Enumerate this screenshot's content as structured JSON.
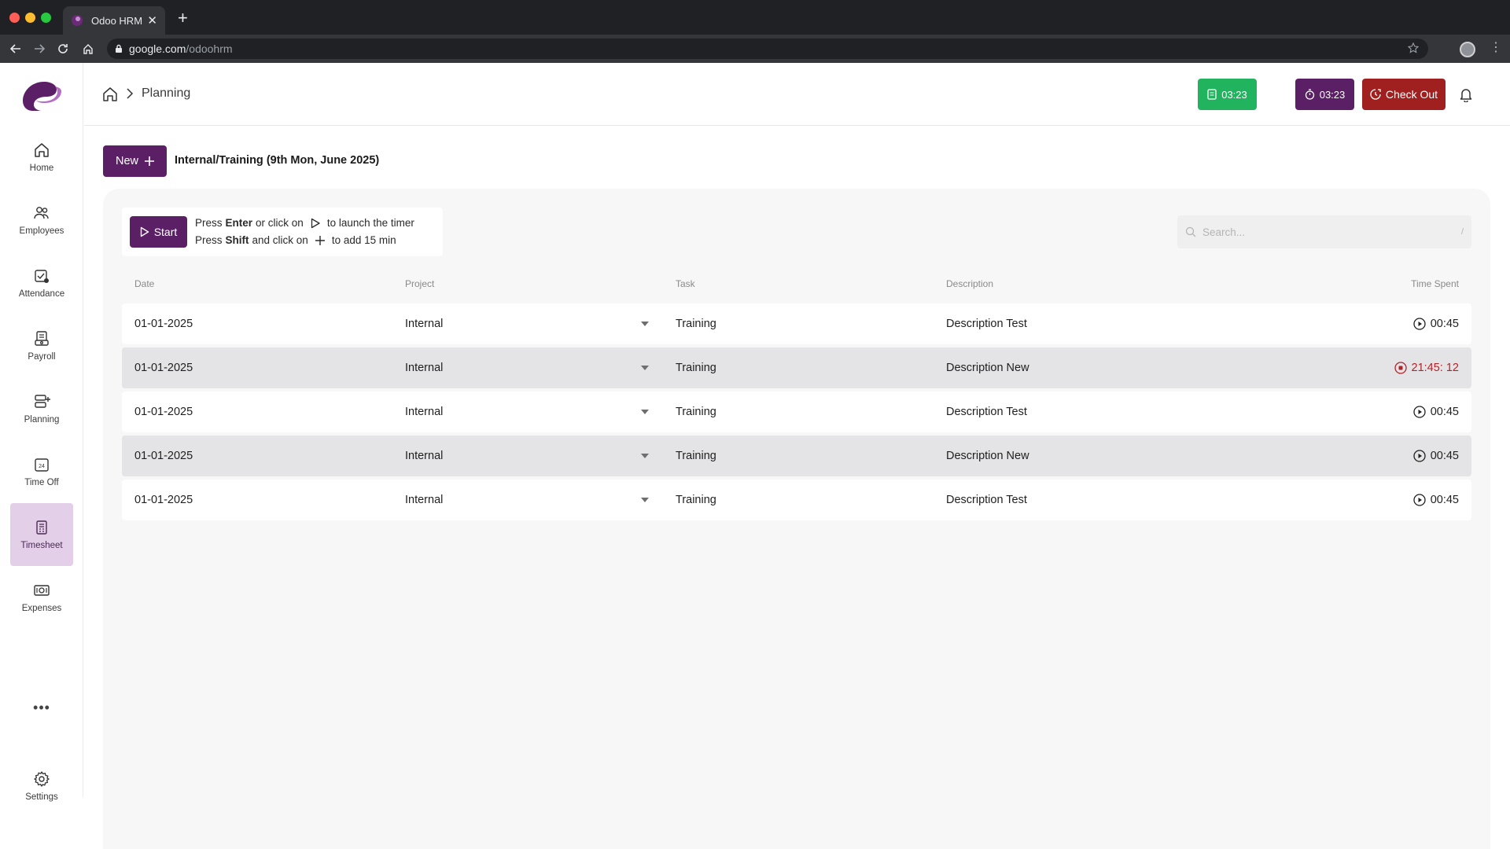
{
  "browser": {
    "tab_title": "Odoo HRM",
    "url_host": "google.com",
    "url_path": "/odoohrm"
  },
  "colors": {
    "brand_purple": "#5b1f66",
    "success_green": "#22b35e",
    "danger_red": "#a0201f",
    "active_nav_bg": "#e3cfe8"
  },
  "sidebar": {
    "items": [
      {
        "label": "Home",
        "icon": "home-icon"
      },
      {
        "label": "Employees",
        "icon": "users-icon"
      },
      {
        "label": "Attendance",
        "icon": "calendar-check-icon"
      },
      {
        "label": "Payroll",
        "icon": "payroll-icon"
      },
      {
        "label": "Planning",
        "icon": "planning-icon"
      },
      {
        "label": "Time Off",
        "icon": "time-off-icon"
      },
      {
        "label": "Timesheet",
        "icon": "timesheet-icon",
        "active": true
      },
      {
        "label": "Expenses",
        "icon": "expenses-icon"
      }
    ],
    "more": "•••",
    "settings_label": "Settings"
  },
  "header": {
    "breadcrumb_title": "Planning",
    "timer_green": "03:23",
    "timer_purple": "03:23",
    "checkout_label": "Check Out"
  },
  "actions": {
    "new_label": "New",
    "context_title": "Internal/Training (9th Mon, June 2025)"
  },
  "hint": {
    "start_label": "Start",
    "line1_pre": "Press",
    "line1_key": "Enter",
    "line1_mid": "or click on",
    "line1_post": "to launch the timer",
    "line2_pre": "Press",
    "line2_key": "Shift",
    "line2_mid": "and click on",
    "line2_post": "to add 15 min"
  },
  "search": {
    "placeholder": "Search...",
    "shortcut": "/"
  },
  "table": {
    "columns": [
      "Date",
      "Project",
      "Task",
      "Description",
      "Time Spent"
    ],
    "rows": [
      {
        "date": "01-01-2025",
        "project": "Internal",
        "task": "Training",
        "description": "Description Test",
        "time": "00:45",
        "running": false
      },
      {
        "date": "01-01-2025",
        "project": "Internal",
        "task": "Training",
        "description": "Description New",
        "time": "21:45: 12",
        "running": true
      },
      {
        "date": "01-01-2025",
        "project": "Internal",
        "task": "Training",
        "description": "Description Test",
        "time": "00:45",
        "running": false
      },
      {
        "date": "01-01-2025",
        "project": "Internal",
        "task": "Training",
        "description": "Description New",
        "time": "00:45",
        "running": false
      },
      {
        "date": "01-01-2025",
        "project": "Internal",
        "task": "Training",
        "description": "Description Test",
        "time": "00:45",
        "running": false
      }
    ]
  }
}
